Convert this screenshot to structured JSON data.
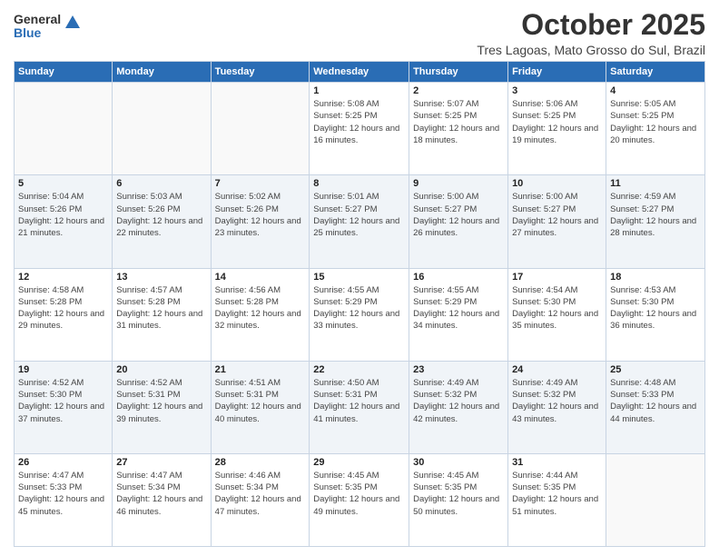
{
  "logo": {
    "general": "General",
    "blue": "Blue"
  },
  "title": "October 2025",
  "location": "Tres Lagoas, Mato Grosso do Sul, Brazil",
  "days_of_week": [
    "Sunday",
    "Monday",
    "Tuesday",
    "Wednesday",
    "Thursday",
    "Friday",
    "Saturday"
  ],
  "weeks": [
    [
      {
        "day": "",
        "sunrise": "",
        "sunset": "",
        "daylight": ""
      },
      {
        "day": "",
        "sunrise": "",
        "sunset": "",
        "daylight": ""
      },
      {
        "day": "",
        "sunrise": "",
        "sunset": "",
        "daylight": ""
      },
      {
        "day": "1",
        "sunrise": "Sunrise: 5:08 AM",
        "sunset": "Sunset: 5:25 PM",
        "daylight": "Daylight: 12 hours and 16 minutes."
      },
      {
        "day": "2",
        "sunrise": "Sunrise: 5:07 AM",
        "sunset": "Sunset: 5:25 PM",
        "daylight": "Daylight: 12 hours and 18 minutes."
      },
      {
        "day": "3",
        "sunrise": "Sunrise: 5:06 AM",
        "sunset": "Sunset: 5:25 PM",
        "daylight": "Daylight: 12 hours and 19 minutes."
      },
      {
        "day": "4",
        "sunrise": "Sunrise: 5:05 AM",
        "sunset": "Sunset: 5:25 PM",
        "daylight": "Daylight: 12 hours and 20 minutes."
      }
    ],
    [
      {
        "day": "5",
        "sunrise": "Sunrise: 5:04 AM",
        "sunset": "Sunset: 5:26 PM",
        "daylight": "Daylight: 12 hours and 21 minutes."
      },
      {
        "day": "6",
        "sunrise": "Sunrise: 5:03 AM",
        "sunset": "Sunset: 5:26 PM",
        "daylight": "Daylight: 12 hours and 22 minutes."
      },
      {
        "day": "7",
        "sunrise": "Sunrise: 5:02 AM",
        "sunset": "Sunset: 5:26 PM",
        "daylight": "Daylight: 12 hours and 23 minutes."
      },
      {
        "day": "8",
        "sunrise": "Sunrise: 5:01 AM",
        "sunset": "Sunset: 5:27 PM",
        "daylight": "Daylight: 12 hours and 25 minutes."
      },
      {
        "day": "9",
        "sunrise": "Sunrise: 5:00 AM",
        "sunset": "Sunset: 5:27 PM",
        "daylight": "Daylight: 12 hours and 26 minutes."
      },
      {
        "day": "10",
        "sunrise": "Sunrise: 5:00 AM",
        "sunset": "Sunset: 5:27 PM",
        "daylight": "Daylight: 12 hours and 27 minutes."
      },
      {
        "day": "11",
        "sunrise": "Sunrise: 4:59 AM",
        "sunset": "Sunset: 5:27 PM",
        "daylight": "Daylight: 12 hours and 28 minutes."
      }
    ],
    [
      {
        "day": "12",
        "sunrise": "Sunrise: 4:58 AM",
        "sunset": "Sunset: 5:28 PM",
        "daylight": "Daylight: 12 hours and 29 minutes."
      },
      {
        "day": "13",
        "sunrise": "Sunrise: 4:57 AM",
        "sunset": "Sunset: 5:28 PM",
        "daylight": "Daylight: 12 hours and 31 minutes."
      },
      {
        "day": "14",
        "sunrise": "Sunrise: 4:56 AM",
        "sunset": "Sunset: 5:28 PM",
        "daylight": "Daylight: 12 hours and 32 minutes."
      },
      {
        "day": "15",
        "sunrise": "Sunrise: 4:55 AM",
        "sunset": "Sunset: 5:29 PM",
        "daylight": "Daylight: 12 hours and 33 minutes."
      },
      {
        "day": "16",
        "sunrise": "Sunrise: 4:55 AM",
        "sunset": "Sunset: 5:29 PM",
        "daylight": "Daylight: 12 hours and 34 minutes."
      },
      {
        "day": "17",
        "sunrise": "Sunrise: 4:54 AM",
        "sunset": "Sunset: 5:30 PM",
        "daylight": "Daylight: 12 hours and 35 minutes."
      },
      {
        "day": "18",
        "sunrise": "Sunrise: 4:53 AM",
        "sunset": "Sunset: 5:30 PM",
        "daylight": "Daylight: 12 hours and 36 minutes."
      }
    ],
    [
      {
        "day": "19",
        "sunrise": "Sunrise: 4:52 AM",
        "sunset": "Sunset: 5:30 PM",
        "daylight": "Daylight: 12 hours and 37 minutes."
      },
      {
        "day": "20",
        "sunrise": "Sunrise: 4:52 AM",
        "sunset": "Sunset: 5:31 PM",
        "daylight": "Daylight: 12 hours and 39 minutes."
      },
      {
        "day": "21",
        "sunrise": "Sunrise: 4:51 AM",
        "sunset": "Sunset: 5:31 PM",
        "daylight": "Daylight: 12 hours and 40 minutes."
      },
      {
        "day": "22",
        "sunrise": "Sunrise: 4:50 AM",
        "sunset": "Sunset: 5:31 PM",
        "daylight": "Daylight: 12 hours and 41 minutes."
      },
      {
        "day": "23",
        "sunrise": "Sunrise: 4:49 AM",
        "sunset": "Sunset: 5:32 PM",
        "daylight": "Daylight: 12 hours and 42 minutes."
      },
      {
        "day": "24",
        "sunrise": "Sunrise: 4:49 AM",
        "sunset": "Sunset: 5:32 PM",
        "daylight": "Daylight: 12 hours and 43 minutes."
      },
      {
        "day": "25",
        "sunrise": "Sunrise: 4:48 AM",
        "sunset": "Sunset: 5:33 PM",
        "daylight": "Daylight: 12 hours and 44 minutes."
      }
    ],
    [
      {
        "day": "26",
        "sunrise": "Sunrise: 4:47 AM",
        "sunset": "Sunset: 5:33 PM",
        "daylight": "Daylight: 12 hours and 45 minutes."
      },
      {
        "day": "27",
        "sunrise": "Sunrise: 4:47 AM",
        "sunset": "Sunset: 5:34 PM",
        "daylight": "Daylight: 12 hours and 46 minutes."
      },
      {
        "day": "28",
        "sunrise": "Sunrise: 4:46 AM",
        "sunset": "Sunset: 5:34 PM",
        "daylight": "Daylight: 12 hours and 47 minutes."
      },
      {
        "day": "29",
        "sunrise": "Sunrise: 4:45 AM",
        "sunset": "Sunset: 5:35 PM",
        "daylight": "Daylight: 12 hours and 49 minutes."
      },
      {
        "day": "30",
        "sunrise": "Sunrise: 4:45 AM",
        "sunset": "Sunset: 5:35 PM",
        "daylight": "Daylight: 12 hours and 50 minutes."
      },
      {
        "day": "31",
        "sunrise": "Sunrise: 4:44 AM",
        "sunset": "Sunset: 5:35 PM",
        "daylight": "Daylight: 12 hours and 51 minutes."
      },
      {
        "day": "",
        "sunrise": "",
        "sunset": "",
        "daylight": ""
      }
    ]
  ]
}
